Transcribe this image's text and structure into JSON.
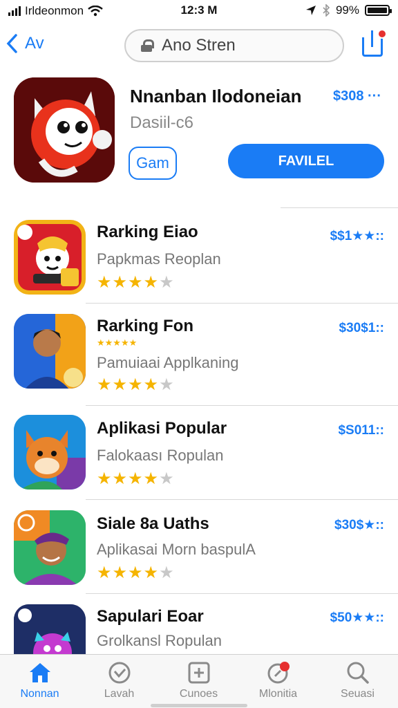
{
  "status_bar": {
    "carrier": "Irldeonmon",
    "time": "12:3 M",
    "battery_text": "99%",
    "icons": [
      "signal-icon",
      "wifi-icon",
      "location-icon",
      "bluetooth-icon",
      "battery-icon"
    ]
  },
  "nav": {
    "back_label": "Av",
    "search_text": "Ano Stren"
  },
  "featured": {
    "title": "Nnanban Ilodoneian",
    "subtitle": "Dasiil-c6",
    "price": "$308 ···",
    "get_label": "Gam",
    "primary_label": "FAVILEL"
  },
  "apps": [
    {
      "title": "Rarking Eiao",
      "subtitle": "Papkmas Reoplan",
      "price": "$$1★★::",
      "rating_stars": 4
    },
    {
      "title": "Rarking Fon",
      "subtitle": "Pamuiaai Applkaning",
      "price": "$30$1::",
      "rating_stars": 4,
      "mini_stars": "★★★★★"
    },
    {
      "title": "Aplikasi Popular",
      "subtitle": "Falokaası Ropulan",
      "price": "$S011::",
      "rating_stars": 4
    },
    {
      "title": "Siale 8a Uaths",
      "subtitle": "Aplikasai Morn baspulA",
      "price": "$30$★::",
      "rating_stars": 4
    },
    {
      "title": "Sapulari Eoar",
      "subtitle": "Grolkansl Ropulan",
      "price": "$50★★::"
    }
  ],
  "tabs": [
    {
      "label": "Nonnan",
      "icon": "home-icon",
      "active": true
    },
    {
      "label": "Lavah",
      "icon": "heart-check-icon",
      "active": false
    },
    {
      "label": "Cunoes",
      "icon": "add-box-icon",
      "active": false
    },
    {
      "label": "Mlonitia",
      "icon": "notification-icon",
      "active": false
    },
    {
      "label": "Seuasi",
      "icon": "search-icon",
      "active": false
    }
  ],
  "colors": {
    "accent": "#1a7cf5",
    "star": "#f5b400",
    "star_off": "#c8c8c8",
    "badge": "#e63030"
  }
}
